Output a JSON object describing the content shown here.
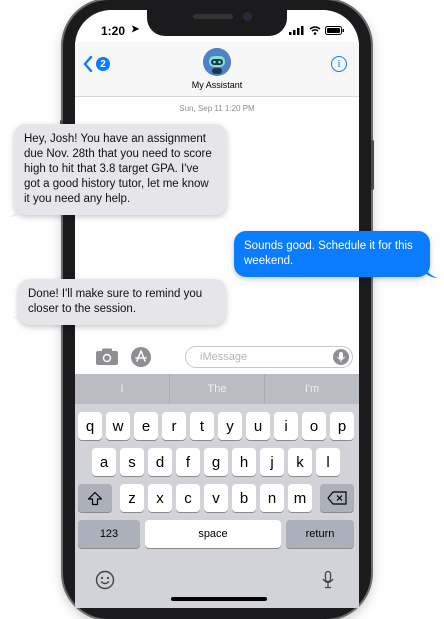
{
  "status": {
    "time": "1:20"
  },
  "header": {
    "unread_count": "2",
    "contact_name": "My Assistant",
    "info_icon": "i"
  },
  "conversation": {
    "timestamp": "Sun, Sep 11 1:20 PM",
    "messages": [
      {
        "from": "assistant",
        "text": "Hey, Josh! You have an assignment due Nov. 28th that you need to score high to hit that 3.8 target GPA. I've got a good history tutor, let me know it you need any help."
      },
      {
        "from": "user",
        "text": "Sounds good. Schedule it for this weekend."
      },
      {
        "from": "assistant",
        "text": "Done! I'll make sure to remind you closer to the session."
      }
    ]
  },
  "input": {
    "placeholder": "iMessage"
  },
  "keyboard": {
    "predictions": [
      "I",
      "The",
      "I'm"
    ],
    "row1": [
      "q",
      "w",
      "e",
      "r",
      "t",
      "y",
      "u",
      "i",
      "o",
      "p"
    ],
    "row2": [
      "a",
      "s",
      "d",
      "f",
      "g",
      "h",
      "j",
      "k",
      "l"
    ],
    "row3": [
      "z",
      "x",
      "c",
      "v",
      "b",
      "n",
      "m"
    ],
    "numbers_label": "123",
    "space_label": "space",
    "return_label": "return"
  },
  "colors": {
    "accent": "#0a7cff",
    "incoming_bubble": "#e5e5ea",
    "outgoing_bubble": "#0a7cff",
    "keyboard_bg": "#d1d3d9"
  },
  "icons": [
    "back-chevron-icon",
    "assistant-robot-icon",
    "info-icon",
    "camera-icon",
    "app-store-icon",
    "microphone-icon",
    "shift-icon",
    "delete-icon",
    "emoji-icon",
    "dictation-icon"
  ]
}
